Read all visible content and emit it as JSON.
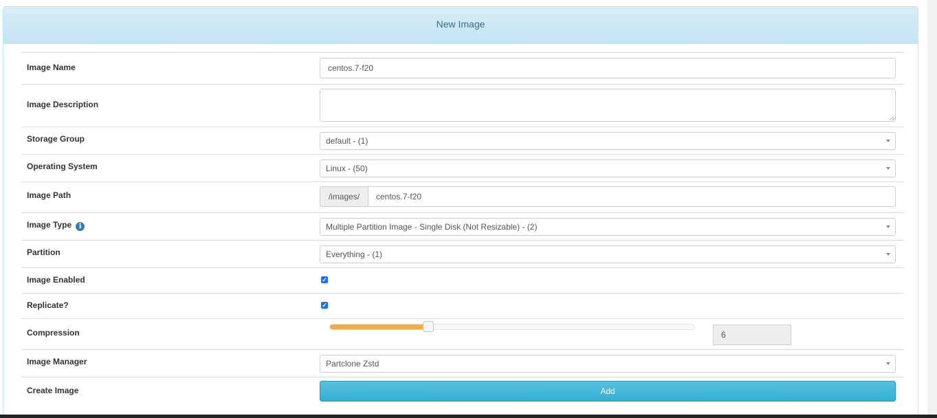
{
  "panel": {
    "title": "New Image"
  },
  "fields": {
    "image_name": {
      "label": "Image Name",
      "value": "centos.7-f20"
    },
    "image_description": {
      "label": "Image Description",
      "value": ""
    },
    "storage_group": {
      "label": "Storage Group",
      "value": "default - (1)"
    },
    "operating_system": {
      "label": "Operating System",
      "value": "Linux - (50)"
    },
    "image_path": {
      "label": "Image Path",
      "prefix": "/images/",
      "value": "centos.7-f20"
    },
    "image_type": {
      "label": "Image Type",
      "value": "Multiple Partition Image - Single Disk (Not Resizable) - (2)",
      "icon": "info-icon"
    },
    "partition": {
      "label": "Partition",
      "value": "Everything - (1)"
    },
    "image_enabled": {
      "label": "Image Enabled",
      "checked": true
    },
    "replicate": {
      "label": "Replicate?",
      "checked": true
    },
    "compression": {
      "label": "Compression",
      "value": "6",
      "level_fraction": 0.27
    },
    "image_manager": {
      "label": "Image Manager",
      "value": "Partclone Zstd"
    },
    "create_image": {
      "label": "Create Image",
      "button": "Add"
    }
  },
  "colors": {
    "heading_bg": "#d9edf7",
    "heading_text": "#31708f",
    "slider_fill": "#f0ad4e",
    "button": "#5bc0de",
    "checkbox": "#1a73e8"
  }
}
